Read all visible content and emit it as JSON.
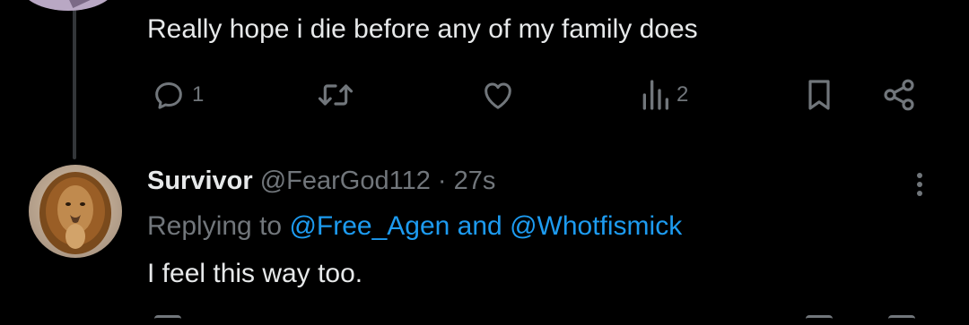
{
  "tweet": {
    "text": "Really hope i die before any of my family does",
    "reply_count": "1",
    "view_count": "2"
  },
  "reply": {
    "display_name": "Survivor",
    "handle": "@FearGod112",
    "separator": "·",
    "time": "27s",
    "replying_prefix": "Replying to",
    "mention_1": "@Free_Agen",
    "and_word": "and",
    "mention_2": "@Whotfismick",
    "text": "I feel this way too."
  },
  "colors": {
    "background": "#000000",
    "text": "#e7e9ea",
    "muted": "#71767b",
    "accent": "#1d9bf0",
    "thread_line": "#333639"
  },
  "icons": [
    "reply-icon",
    "retweet-icon",
    "like-icon",
    "views-icon",
    "bookmark-icon",
    "share-icon",
    "more-icon"
  ]
}
